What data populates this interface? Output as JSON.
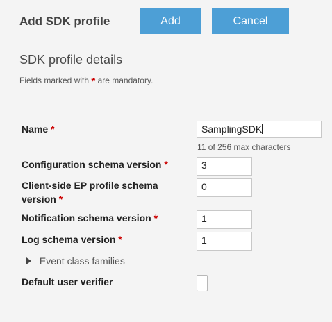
{
  "header": {
    "title": "Add SDK profile",
    "add_label": "Add",
    "cancel_label": "Cancel"
  },
  "section": {
    "title": "SDK profile details",
    "note_before": "Fields marked with",
    "note_star": "*",
    "note_after": "are mandatory."
  },
  "form": {
    "required_marker": "*",
    "name": {
      "label": "Name",
      "value": "SamplingSDK",
      "hint": "11 of 256 max characters"
    },
    "config_schema": {
      "label": "Configuration schema version",
      "value": "3"
    },
    "ep_profile_schema": {
      "label_line1": "Client-side EP profile schema",
      "label_line2": "version",
      "value": "0"
    },
    "notification_schema": {
      "label": "Notification schema version",
      "value": "1"
    },
    "log_schema": {
      "label": "Log schema version",
      "value": "1"
    },
    "event_class_families": {
      "label": "Event class families",
      "icon": "triangle-right-icon"
    },
    "default_user_verifier": {
      "label": "Default user verifier",
      "value": ""
    }
  },
  "colors": {
    "button": "#4d9fd6",
    "required": "#cc0000",
    "background": "#f4f4f4"
  }
}
